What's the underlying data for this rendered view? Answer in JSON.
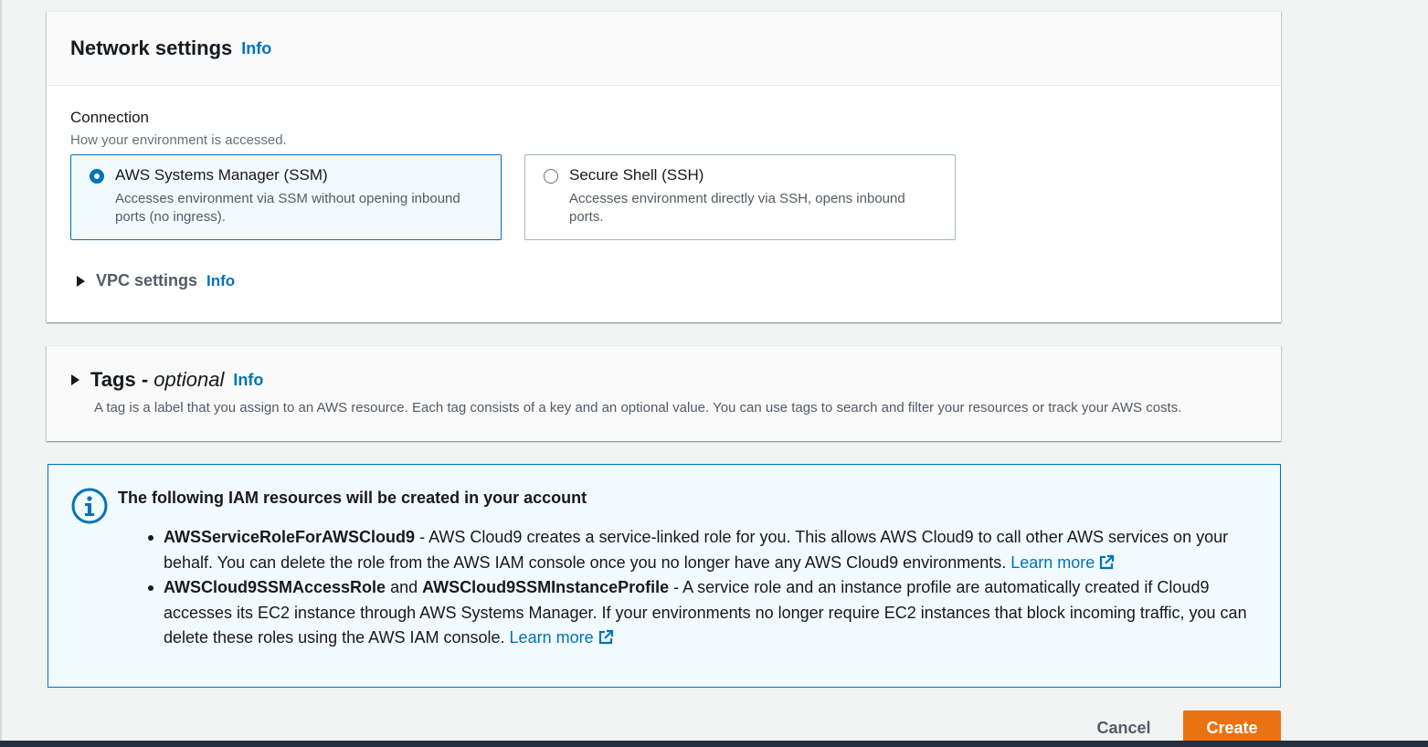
{
  "network": {
    "title": "Network settings",
    "info": "Info",
    "connection_label": "Connection",
    "connection_desc": "How your environment is accessed.",
    "options": [
      {
        "title": "AWS Systems Manager (SSM)",
        "desc": "Accesses environment via SSM without opening inbound ports (no ingress).",
        "selected": true
      },
      {
        "title": "Secure Shell (SSH)",
        "desc": "Accesses environment directly via SSH, opens inbound ports.",
        "selected": false
      }
    ],
    "vpc_label": "VPC settings",
    "vpc_info": "Info"
  },
  "tags": {
    "title": "Tags - ",
    "title_optional": "optional",
    "info": "Info",
    "desc": "A tag is a label that you assign to an AWS resource. Each tag consists of a key and an optional value. You can use tags to search and filter your resources or track your AWS costs."
  },
  "alert": {
    "title": "The following IAM resources will be created in your account",
    "item1": {
      "bold": "AWSServiceRoleForAWSCloud9",
      "text": " - AWS Cloud9 creates a service-linked role for you. This allows AWS Cloud9 to call other AWS services on your behalf. You can delete the role from the AWS IAM console once you no longer have any AWS Cloud9 environments. ",
      "link": "Learn more"
    },
    "item2": {
      "bold1": "AWSCloud9SSMAccessRole",
      "and": " and ",
      "bold2": "AWSCloud9SSMInstanceProfile",
      "text": " - A service role and an instance profile are automatically created if Cloud9 accesses its EC2 instance through AWS Systems Manager. If your environments no longer require EC2 instances that block incoming traffic, you can delete these roles using the AWS IAM console. ",
      "link": "Learn more"
    }
  },
  "actions": {
    "cancel": "Cancel",
    "create": "Create"
  },
  "colors": {
    "accent": "#0073bb",
    "primary_button": "#ec7211",
    "alert_bg": "#f1faff"
  }
}
